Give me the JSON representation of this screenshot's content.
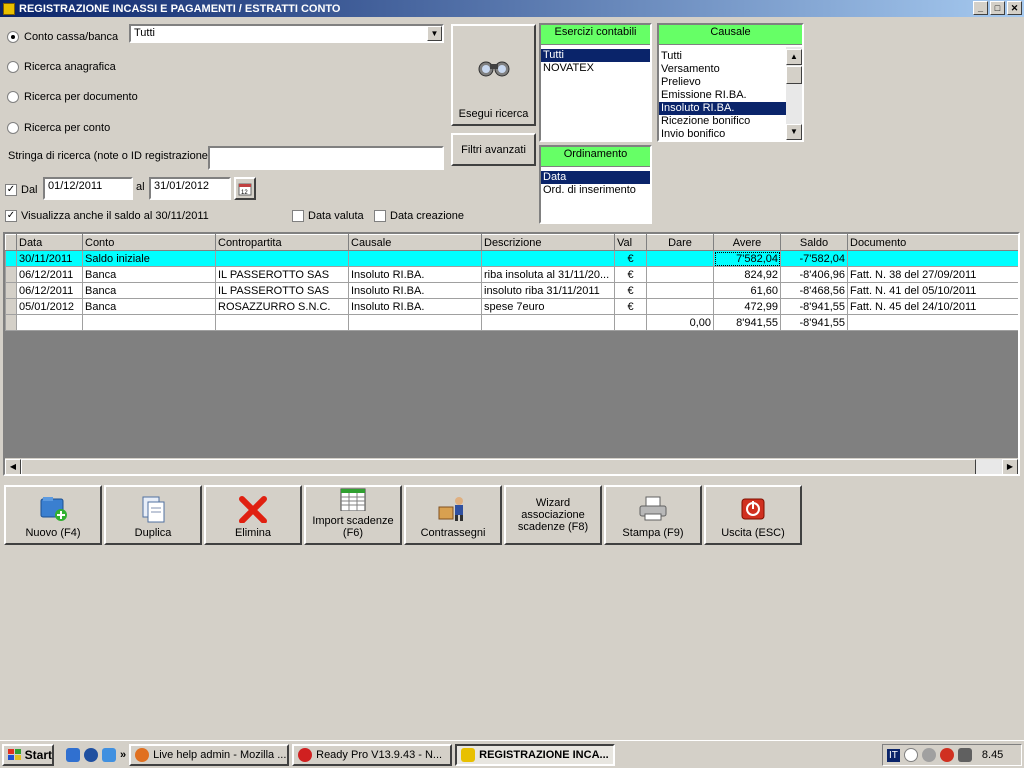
{
  "window": {
    "title": "REGISTRAZIONE INCASSI E PAGAMENTI / ESTRATTI CONTO"
  },
  "filters": {
    "radio_conto": "Conto cassa/banca",
    "conto_value": "Tutti",
    "radio_anagrafica": "Ricerca anagrafica",
    "radio_documento": "Ricerca per documento",
    "radio_per_conto": "Ricerca per conto",
    "search_label": "Stringa di ricerca (note o ID registrazione)",
    "search_value": "",
    "dal_label": "Dal",
    "dal_value": "01/12/2011",
    "al_label": "al",
    "al_value": "31/01/2012",
    "saldo_label": "Visualizza anche il saldo al 30/11/2011",
    "data_valuta_label": "Data valuta",
    "data_creazione_label": "Data creazione"
  },
  "search_button": "Esegui ricerca",
  "advanced_filters_button": "Filtri avanzati",
  "esercizi": {
    "title": "Esercizi contabili",
    "items": [
      "Tutti",
      "NOVATEX"
    ]
  },
  "ordinamento": {
    "title": "Ordinamento",
    "items": [
      "Data",
      "Ord. di inserimento"
    ]
  },
  "causale": {
    "title": "Causale",
    "items": [
      "Tutti",
      "Versamento",
      "Prelievo",
      "Emissione RI.BA.",
      "Insoluto RI.BA.",
      "Ricezione bonifico",
      "Invio bonifico"
    ]
  },
  "table": {
    "columns": [
      "Data",
      "Conto",
      "Contropartita",
      "Causale",
      "Descrizione",
      "Val",
      "Dare",
      "Avere",
      "Saldo",
      "Documento"
    ],
    "rows": [
      [
        "30/11/2011",
        "Saldo iniziale",
        "",
        "",
        "",
        "€",
        "",
        "7'582,04",
        "-7'582,04",
        ""
      ],
      [
        "06/12/2011",
        "Banca",
        "IL PASSEROTTO SAS",
        "Insoluto RI.BA.",
        "riba insoluta al 31/11/20...",
        "€",
        "",
        "824,92",
        "-8'406,96",
        "Fatt. N. 38 del 27/09/2011"
      ],
      [
        "06/12/2011",
        "Banca",
        "IL PASSEROTTO SAS",
        "Insoluto RI.BA.",
        "insoluto riba 31/11/2011",
        "€",
        "",
        "61,60",
        "-8'468,56",
        "Fatt. N. 41 del 05/10/2011"
      ],
      [
        "05/01/2012",
        "Banca",
        "ROSAZZURRO S.N.C.",
        "Insoluto RI.BA.",
        "spese 7euro",
        "€",
        "",
        "472,99",
        "-8'941,55",
        "Fatt. N. 45 del 24/10/2011"
      ]
    ],
    "totals": [
      "",
      "",
      "",
      "",
      "",
      "",
      "0,00",
      "8'941,55",
      "-8'941,55",
      ""
    ]
  },
  "toolbar": {
    "nuovo": "Nuovo (F4)",
    "duplica": "Duplica",
    "elimina": "Elimina",
    "import": "Import scadenze (F6)",
    "contrassegni": "Contrassegni",
    "wizard": "Wizard associazione scadenze (F8)",
    "stampa": "Stampa (F9)",
    "uscita": "Uscita (ESC)"
  },
  "taskbar": {
    "start": "Start",
    "tasks": [
      "Live help admin - Mozilla ...",
      "Ready Pro V13.9.43 - N...",
      "REGISTRAZIONE INCA..."
    ],
    "lang": "IT",
    "clock": "8.45"
  }
}
